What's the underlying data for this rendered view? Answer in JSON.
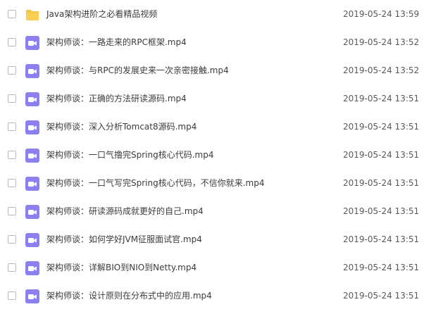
{
  "files": [
    {
      "type": "folder",
      "icon": "folder-icon",
      "name": "Java架构进阶之必看精品视频",
      "modified": "2019-05-24 13:59"
    },
    {
      "type": "video",
      "icon": "video-file-icon",
      "name": "架构师谈：一路走来的RPC框架.mp4",
      "modified": "2019-05-24 13:52"
    },
    {
      "type": "video",
      "icon": "video-file-icon",
      "name": "架构师谈：与RPC的发展史来一次亲密接触.mp4",
      "modified": "2019-05-24 13:52"
    },
    {
      "type": "video",
      "icon": "video-file-icon",
      "name": "架构师谈：正确的方法研读源码.mp4",
      "modified": "2019-05-24 13:51"
    },
    {
      "type": "video",
      "icon": "video-file-icon",
      "name": "架构师谈：深入分析Tomcat8源码.mp4",
      "modified": "2019-05-24 13:51"
    },
    {
      "type": "video",
      "icon": "video-file-icon",
      "name": "架构师谈：一口气撸完Spring核心代码.mp4",
      "modified": "2019-05-24 13:51"
    },
    {
      "type": "video",
      "icon": "video-file-icon",
      "name": "架构师谈：一口气写完Spring核心代码，不信你就来.mp4",
      "modified": "2019-05-24 13:51"
    },
    {
      "type": "video",
      "icon": "video-file-icon",
      "name": "架构师谈：研读源码成就更好的自己.mp4",
      "modified": "2019-05-24 13:51"
    },
    {
      "type": "video",
      "icon": "video-file-icon",
      "name": "架构师谈：如何学好JVM征服面试官.mp4",
      "modified": "2019-05-24 13:51"
    },
    {
      "type": "video",
      "icon": "video-file-icon",
      "name": "架构师谈：详解BIO到NIO到Netty.mp4",
      "modified": "2019-05-24 13:51"
    },
    {
      "type": "video",
      "icon": "video-file-icon",
      "name": "架构师谈：设计原则在分布式中的应用.mp4",
      "modified": "2019-05-24 13:51"
    }
  ],
  "colors": {
    "folder": "#f7c544",
    "video": "#8c7ff2"
  }
}
